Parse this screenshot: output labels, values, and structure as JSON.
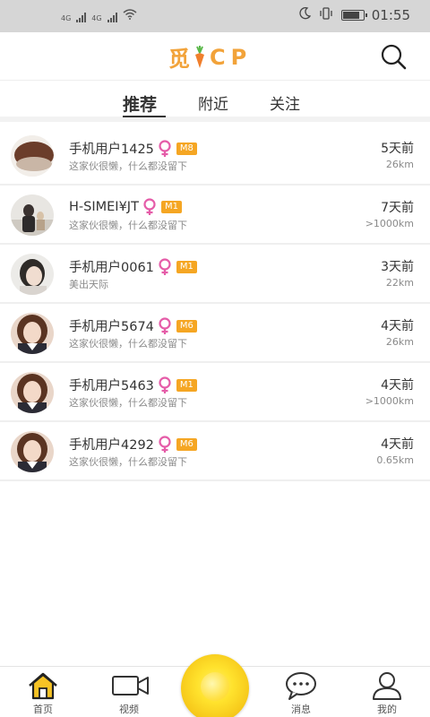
{
  "status_bar": {
    "net1": "4G",
    "net2": "4G",
    "time": "01:55"
  },
  "header": {
    "logo_text_left": "觅",
    "logo_text_right": "CP"
  },
  "tabs": [
    {
      "label": "推荐",
      "active": true
    },
    {
      "label": "附近",
      "active": false
    },
    {
      "label": "关注",
      "active": false
    }
  ],
  "users": [
    {
      "name": "手机用户1425",
      "level": "M8",
      "bio": "这家伙很懒，什么都没留下",
      "time": "5天前",
      "distance": "26km"
    },
    {
      "name": "H-SIMEI¥JT",
      "level": "M1",
      "bio": "这家伙很懒，什么都没留下",
      "time": "7天前",
      "distance": ">1000km"
    },
    {
      "name": "手机用户0061",
      "level": "M1",
      "bio": "美出天际",
      "time": "3天前",
      "distance": "22km"
    },
    {
      "name": "手机用户5674",
      "level": "M6",
      "bio": "这家伙很懒，什么都没留下",
      "time": "4天前",
      "distance": "26km"
    },
    {
      "name": "手机用户5463",
      "level": "M1",
      "bio": "这家伙很懒，什么都没留下",
      "time": "4天前",
      "distance": ">1000km"
    },
    {
      "name": "手机用户4292",
      "level": "M6",
      "bio": "这家伙很懒，什么都没留下",
      "time": "4天前",
      "distance": "0.65km"
    }
  ],
  "tabbar": {
    "home": "首页",
    "video": "视频",
    "messages": "消息",
    "mine": "我的"
  },
  "colors": {
    "accent": "#f5a623",
    "female": "#e55ca8",
    "logo": "#f2a33a"
  }
}
